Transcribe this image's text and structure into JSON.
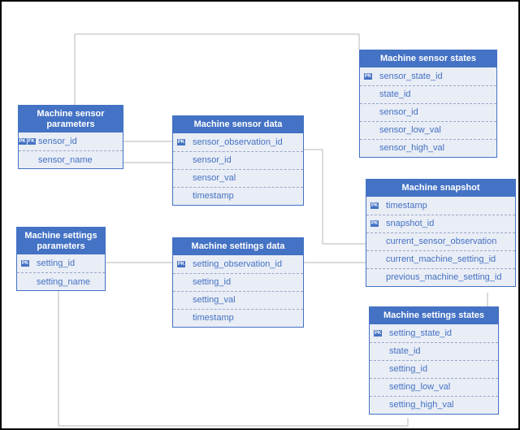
{
  "chart_data": {
    "type": "er-diagram",
    "entities": [
      {
        "name": "Machine sensor parameters",
        "attributes": [
          {
            "name": "sensor_id",
            "pk": true,
            "fk": true
          },
          {
            "name": "sensor_name"
          }
        ]
      },
      {
        "name": "Machine sensor data",
        "attributes": [
          {
            "name": "sensor_observation_id",
            "pk": true
          },
          {
            "name": "sensor_id"
          },
          {
            "name": "sensor_val"
          },
          {
            "name": "timestamp"
          }
        ]
      },
      {
        "name": "Machine sensor states",
        "attributes": [
          {
            "name": "sensor_state_id",
            "pk": true
          },
          {
            "name": "state_id"
          },
          {
            "name": "sensor_id"
          },
          {
            "name": "sensor_low_val"
          },
          {
            "name": "sensor_high_val"
          }
        ]
      },
      {
        "name": "Machine settings parameters",
        "attributes": [
          {
            "name": "setting_id",
            "pk": true
          },
          {
            "name": "setting_name"
          }
        ]
      },
      {
        "name": "Machine settings data",
        "attributes": [
          {
            "name": "setting_observation_id",
            "pk": true
          },
          {
            "name": "setting_id"
          },
          {
            "name": "setting_val"
          },
          {
            "name": "timestamp"
          }
        ]
      },
      {
        "name": "Machine snapshot",
        "attributes": [
          {
            "name": "timestamp",
            "pk": true
          },
          {
            "name": "snapshot_id",
            "pk": true
          },
          {
            "name": "current_sensor_observation"
          },
          {
            "name": "current_machine_setting_id"
          },
          {
            "name": "previous_machine_setting_id"
          }
        ]
      },
      {
        "name": "Machine settings states",
        "attributes": [
          {
            "name": "setting_state_id",
            "pk": true
          },
          {
            "name": "state_id"
          },
          {
            "name": "setting_id"
          },
          {
            "name": "setting_low_val"
          },
          {
            "name": "setting_high_val"
          }
        ]
      }
    ],
    "relationships": [
      {
        "from": "Machine sensor parameters.sensor_id",
        "to": "Machine sensor data.sensor_id"
      },
      {
        "from": "Machine sensor parameters.sensor_id",
        "to": "Machine sensor states.sensor_id"
      },
      {
        "from": "Machine settings parameters.setting_id",
        "to": "Machine settings data.setting_id"
      },
      {
        "from": "Machine settings parameters.setting_id",
        "to": "Machine settings states.setting_id"
      },
      {
        "from": "Machine sensor data.sensor_observation_id",
        "to": "Machine snapshot.current_sensor_observation"
      },
      {
        "from": "Machine settings data.setting_observation_id",
        "to": "Machine snapshot.current_machine_setting_id"
      },
      {
        "from": "Machine snapshot.snapshot_id",
        "to": "Machine settings states"
      }
    ]
  },
  "entities": {
    "sensor_params": {
      "title": "Machine sensor\nparameters",
      "rows": [
        {
          "keys": [
            "PK",
            "FK"
          ],
          "label": "sensor_id"
        },
        {
          "keys": [],
          "label": "sensor_name"
        }
      ]
    },
    "sensor_data": {
      "title": "Machine sensor data",
      "rows": [
        {
          "keys": [
            "PK"
          ],
          "label": "sensor_observation_id"
        },
        {
          "keys": [],
          "label": "sensor_id"
        },
        {
          "keys": [],
          "label": "sensor_val"
        },
        {
          "keys": [],
          "label": "timestamp"
        }
      ]
    },
    "sensor_states": {
      "title": "Machine sensor states",
      "rows": [
        {
          "keys": [
            "PK"
          ],
          "label": "sensor_state_id"
        },
        {
          "keys": [],
          "label": "state_id"
        },
        {
          "keys": [],
          "label": "sensor_id"
        },
        {
          "keys": [],
          "label": "sensor_low_val"
        },
        {
          "keys": [],
          "label": "sensor_high_val"
        }
      ]
    },
    "settings_params": {
      "title": "Machine settings\nparameters",
      "rows": [
        {
          "keys": [
            "PK"
          ],
          "label": "setting_id"
        },
        {
          "keys": [],
          "label": "setting_name"
        }
      ]
    },
    "settings_data": {
      "title": "Machine settings data",
      "rows": [
        {
          "keys": [
            "PK"
          ],
          "label": "setting_observation_id"
        },
        {
          "keys": [],
          "label": "setting_id"
        },
        {
          "keys": [],
          "label": "setting_val"
        },
        {
          "keys": [],
          "label": "timestamp"
        }
      ]
    },
    "snapshot": {
      "title": "Machine snapshot",
      "rows": [
        {
          "keys": [
            "PK"
          ],
          "label": "timestamp"
        },
        {
          "keys": [
            "PK"
          ],
          "label": "snapshot_id"
        },
        {
          "keys": [],
          "label": "current_sensor_observation"
        },
        {
          "keys": [],
          "label": "current_machine_setting_id"
        },
        {
          "keys": [],
          "label": "previous_machine_setting_id"
        }
      ]
    },
    "settings_states": {
      "title": "Machine settings states",
      "rows": [
        {
          "keys": [
            "PK"
          ],
          "label": "setting_state_id"
        },
        {
          "keys": [],
          "label": "state_id"
        },
        {
          "keys": [],
          "label": "setting_id"
        },
        {
          "keys": [],
          "label": "setting_low_val"
        },
        {
          "keys": [],
          "label": "setting_high_val"
        }
      ]
    }
  }
}
